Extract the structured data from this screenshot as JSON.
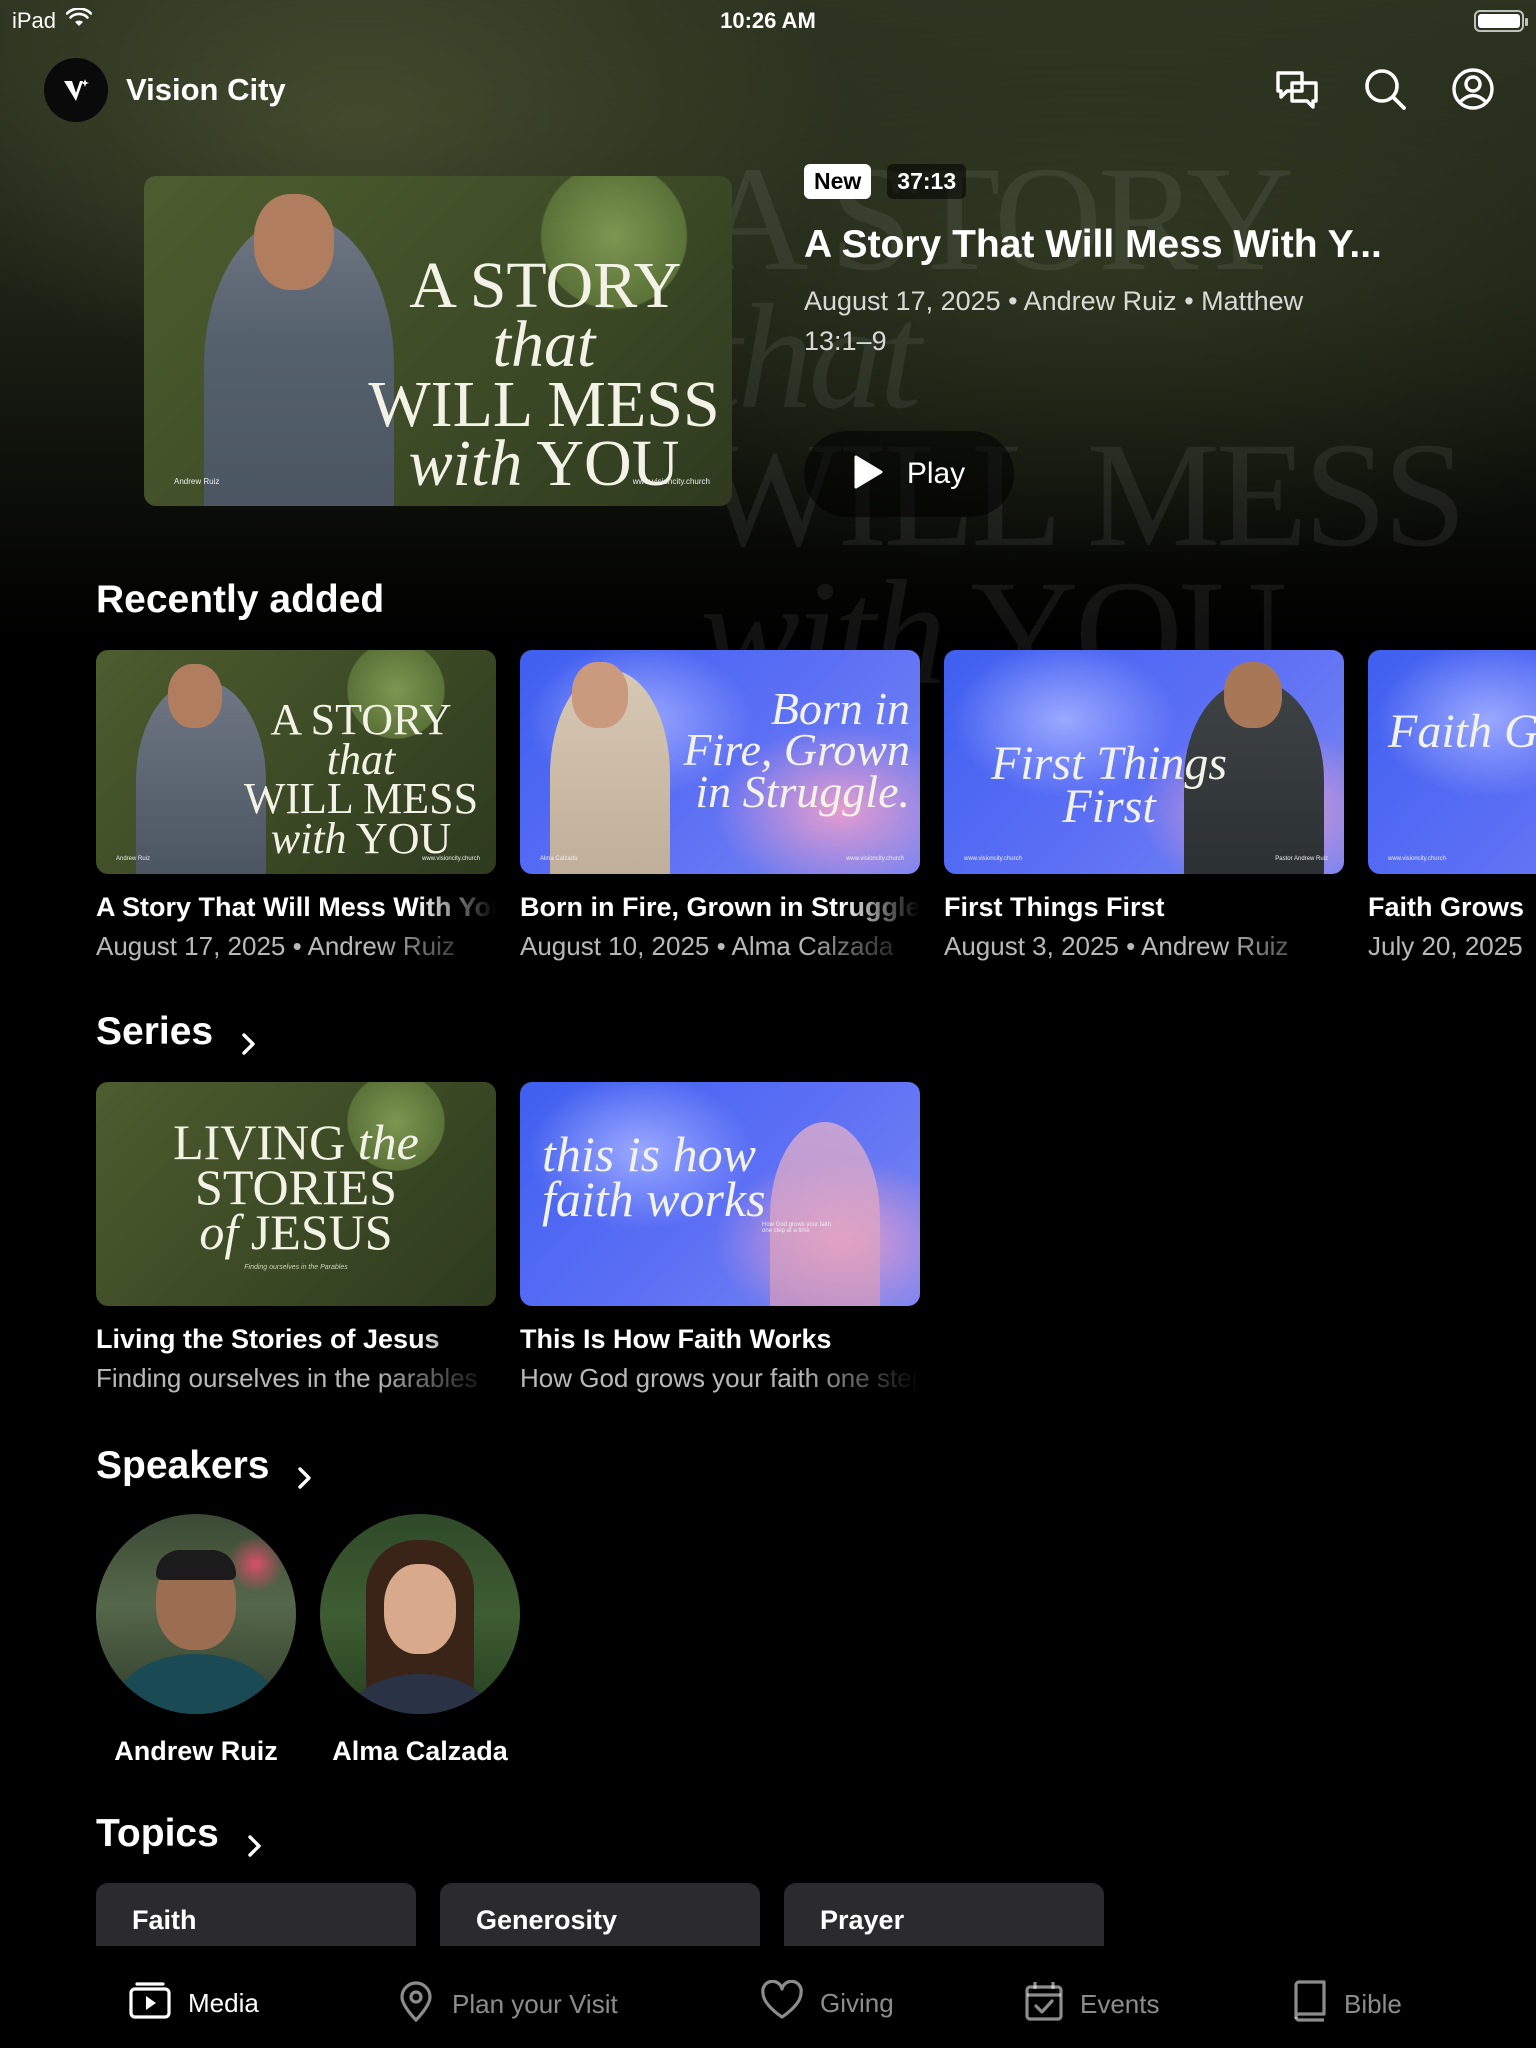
{
  "status_bar": {
    "device": "iPad",
    "time": "10:26 AM"
  },
  "header": {
    "app_name": "Vision City"
  },
  "hero": {
    "badge_new": "New",
    "duration": "37:13",
    "title": "A Story That Will Mess With Y...",
    "meta": "August 17, 2025 • Andrew Ruiz • Matthew 13:1–9",
    "play_label": "Play",
    "thumb": {
      "line1": "A STORY",
      "line1_em": "that",
      "line2": "WILL MESS",
      "line3_em": "with",
      "line3": "YOU",
      "speaker_credit": "Andrew Ruiz",
      "site_credit": "www.visioncity.church"
    }
  },
  "recently_added": {
    "title": "Recently added",
    "items": [
      {
        "title": "A Story That Will Mess With You",
        "subtitle": "August 17, 2025 • Andrew Ruiz",
        "thumb_text": "A STORY that WILL MESS with YOU",
        "credit": "Andrew Ruiz",
        "site": "www.visioncity.church"
      },
      {
        "title": "Born in Fire, Grown in Struggle",
        "subtitle": "August 10, 2025 • Alma Calzada",
        "thumb_text": "Born in Fire, Grown in Struggle.",
        "credit": "Alma Calzada",
        "site": "www.visioncity.church"
      },
      {
        "title": "First Things First",
        "subtitle": "August 3, 2025 • Andrew Ruiz",
        "thumb_text": "First Things First",
        "credit": "Pastor Andrew Ruiz",
        "site": "www.visioncity.church"
      },
      {
        "title": "Faith Grows",
        "subtitle": "July 20, 2025",
        "thumb_text": "Faith Grows When Yo",
        "credit": "",
        "site": "www.visioncity.church"
      }
    ]
  },
  "series": {
    "title": "Series",
    "items": [
      {
        "title": "Living the Stories of Jesus",
        "subtitle": "Finding ourselves in the parables",
        "thumb_text": "LIVING the STORIES of JESUS",
        "thumb_sub": "Finding ourselves in the Parables"
      },
      {
        "title": "This Is How Faith Works",
        "subtitle": "How God grows your faith one step at a time",
        "thumb_text": "this is how faith works",
        "thumb_sub": "How God grows your faith one step at a time"
      }
    ]
  },
  "speakers": {
    "title": "Speakers",
    "items": [
      {
        "name": "Andrew Ruiz"
      },
      {
        "name": "Alma Calzada"
      }
    ]
  },
  "topics": {
    "title": "Topics",
    "items": [
      "Faith",
      "Generosity",
      "Prayer"
    ]
  },
  "tab_bar": {
    "items": [
      {
        "label": "Media",
        "icon": "media-icon",
        "active": true
      },
      {
        "label": "Plan your Visit",
        "icon": "location-pin-icon",
        "active": false
      },
      {
        "label": "Giving",
        "icon": "heart-icon",
        "active": false
      },
      {
        "label": "Events",
        "icon": "calendar-check-icon",
        "active": false
      },
      {
        "label": "Bible",
        "icon": "book-icon",
        "active": false
      }
    ]
  },
  "colors": {
    "background": "#000000",
    "hero_green": "#3c4a26",
    "thumb_blue": "#4f66f2",
    "chip": "#2b2b2d"
  }
}
